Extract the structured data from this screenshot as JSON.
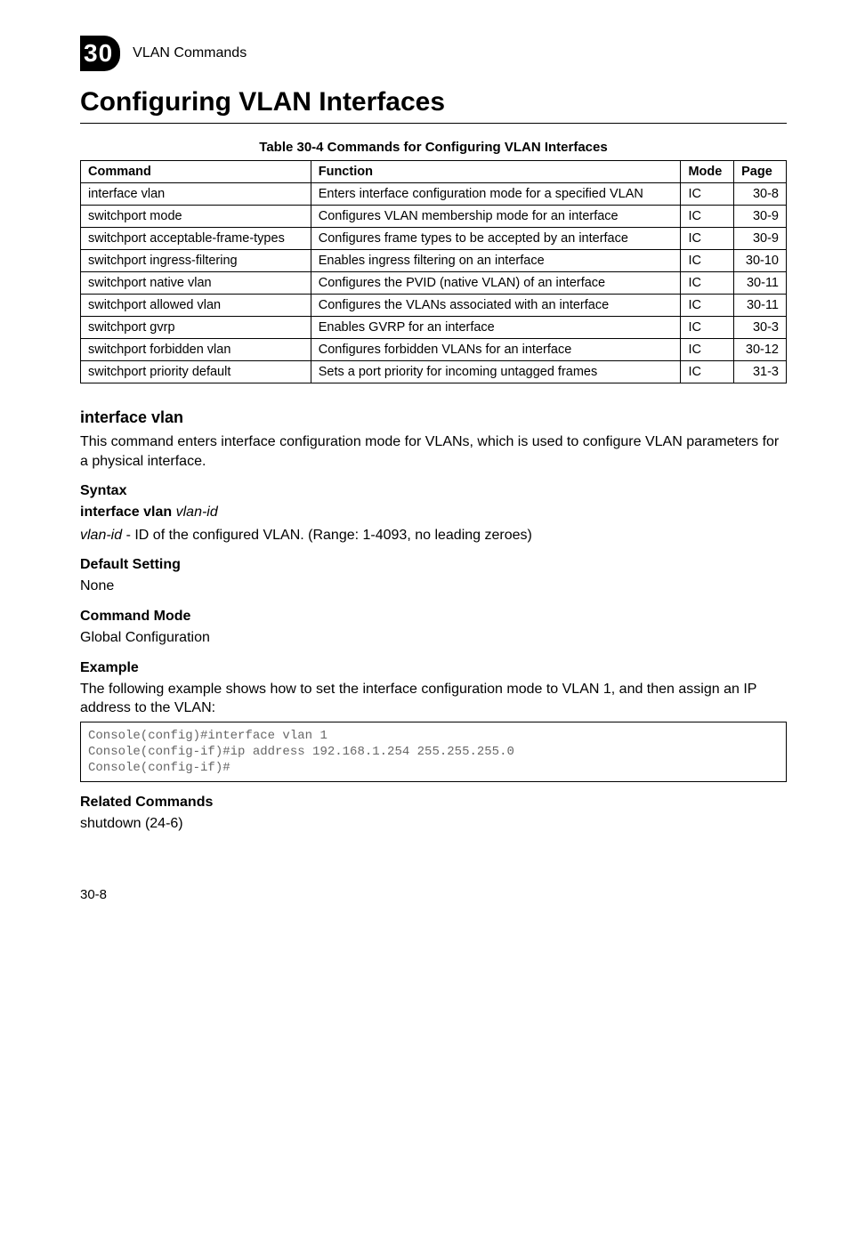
{
  "header": {
    "chapter_num": "30",
    "section": "VLAN Commands"
  },
  "heading": "Configuring VLAN Interfaces",
  "table": {
    "caption": "Table 30-4   Commands for Configuring VLAN Interfaces",
    "headers": {
      "c0": "Command",
      "c1": "Function",
      "c2": "Mode",
      "c3": "Page"
    },
    "rows": [
      {
        "c0": "interface vlan",
        "c1": "Enters interface configuration mode for a specified VLAN",
        "c2": "IC",
        "c3": "30-8"
      },
      {
        "c0": "switchport mode",
        "c1": "Configures VLAN membership mode for an interface",
        "c2": "IC",
        "c3": "30-9"
      },
      {
        "c0": "switchport acceptable-frame-types",
        "c1": "Configures frame types to be accepted by an interface",
        "c2": "IC",
        "c3": "30-9"
      },
      {
        "c0": "switchport ingress-filtering",
        "c1": "Enables ingress filtering on an interface",
        "c2": "IC",
        "c3": "30-10"
      },
      {
        "c0": "switchport native vlan",
        "c1": "Configures the PVID (native VLAN) of an interface",
        "c2": "IC",
        "c3": "30-11"
      },
      {
        "c0": "switchport allowed vlan",
        "c1": "Configures the VLANs associated with an interface",
        "c2": "IC",
        "c3": "30-11"
      },
      {
        "c0": "switchport gvrp",
        "c1": "Enables GVRP for an interface",
        "c2": "IC",
        "c3": "30-3"
      },
      {
        "c0": "switchport forbidden vlan",
        "c1": "Configures forbidden VLANs for an interface",
        "c2": "IC",
        "c3": "30-12"
      },
      {
        "c0": "switchport priority default",
        "c1": "Sets a port priority for incoming untagged frames",
        "c2": "IC",
        "c3": "31-3"
      }
    ]
  },
  "interface_vlan": {
    "title": "interface vlan",
    "description": "This command enters interface configuration mode for VLANs, which is used to configure VLAN parameters for a physical interface.",
    "syntax_label": "Syntax",
    "syntax_cmd_prefix": "interface vlan ",
    "syntax_cmd_arg": "vlan-id",
    "syntax_arg_name": "vlan-id",
    "syntax_arg_desc": " - ID of the configured VLAN. (Range: 1-4093, no leading zeroes)",
    "default_label": "Default Setting",
    "default_value": "None",
    "mode_label": "Command Mode",
    "mode_value": "Global Configuration",
    "example_label": "Example",
    "example_intro": "The following example shows how to set the interface configuration mode to VLAN 1, and then assign an IP address to the VLAN:",
    "code": "Console(config)#interface vlan 1\nConsole(config-if)#ip address 192.168.1.254 255.255.255.0\nConsole(config-if)#",
    "related_label": "Related Commands",
    "related_value": "shutdown (24-6)"
  },
  "footer": "30-8"
}
